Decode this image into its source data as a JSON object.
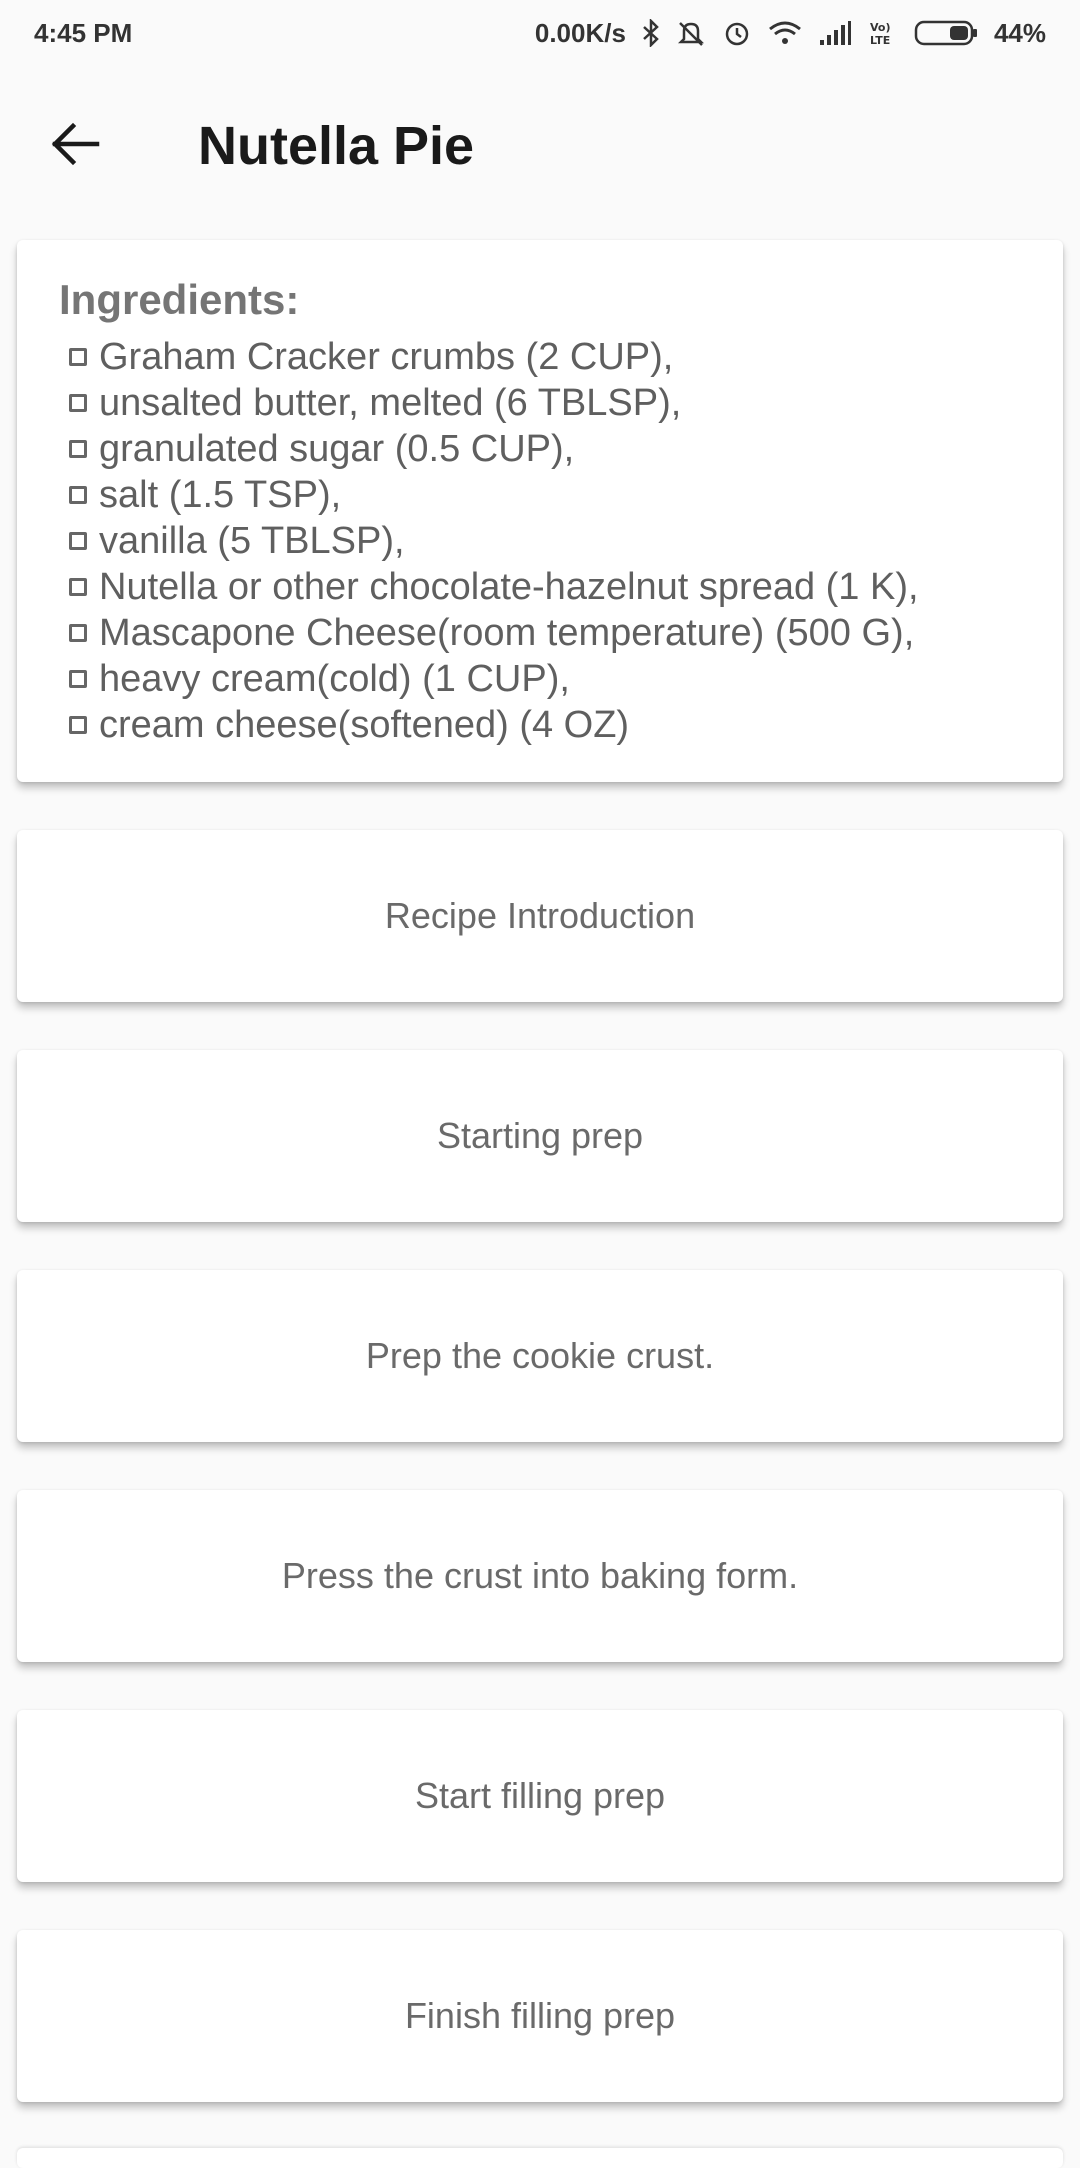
{
  "status_bar": {
    "time": "4:45 PM",
    "network_speed": "0.00K/s",
    "battery": "44%",
    "icons": [
      "bluetooth-icon",
      "mute-icon",
      "alarm-icon",
      "wifi-icon",
      "signal-icon",
      "volte-icon",
      "battery-icon"
    ]
  },
  "toolbar": {
    "back_icon": "arrow-back-icon",
    "title": "Nutella Pie"
  },
  "ingredients": {
    "title": "Ingredients:",
    "items": [
      "Graham Cracker crumbs (2 CUP),",
      "unsalted butter, melted (6 TBLSP),",
      "granulated sugar (0.5 CUP),",
      "salt (1.5 TSP),",
      "vanilla (5 TBLSP),",
      "Nutella or other chocolate-hazelnut spread (1 K),",
      "Mascapone Cheese(room temperature) (500 G),",
      "heavy cream(cold) (1 CUP),",
      "cream cheese(softened) (4 OZ)"
    ]
  },
  "steps": [
    "Recipe Introduction",
    "Starting prep",
    "Prep the cookie crust.",
    "Press the crust into baking form.",
    "Start filling prep",
    "Finish filling prep"
  ],
  "colors": {
    "background": "#fafafa",
    "card": "#ffffff",
    "text_muted": "#6a6a6a",
    "title": "#1a1a1a"
  }
}
